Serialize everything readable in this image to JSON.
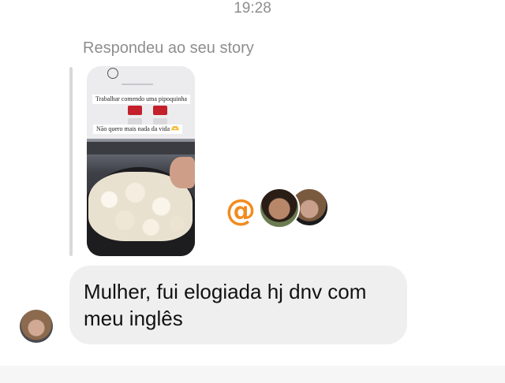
{
  "header": {
    "timestamp": "19:28"
  },
  "reply": {
    "caption": "Respondeu ao seu story",
    "story": {
      "stickers": [
        "Trabalhar comendo uma pipoquinha",
        "Não quero mais nada da vida 🫶"
      ]
    },
    "reactions": {
      "icons": [
        "threads-icon"
      ]
    }
  },
  "message": {
    "text": "Mulher, fui elogiada hj dnv com meu inglês"
  },
  "colors": {
    "bubble": "#efefef",
    "secondary_text": "#8e8e8e",
    "threads_accent": "#f28b1e"
  }
}
